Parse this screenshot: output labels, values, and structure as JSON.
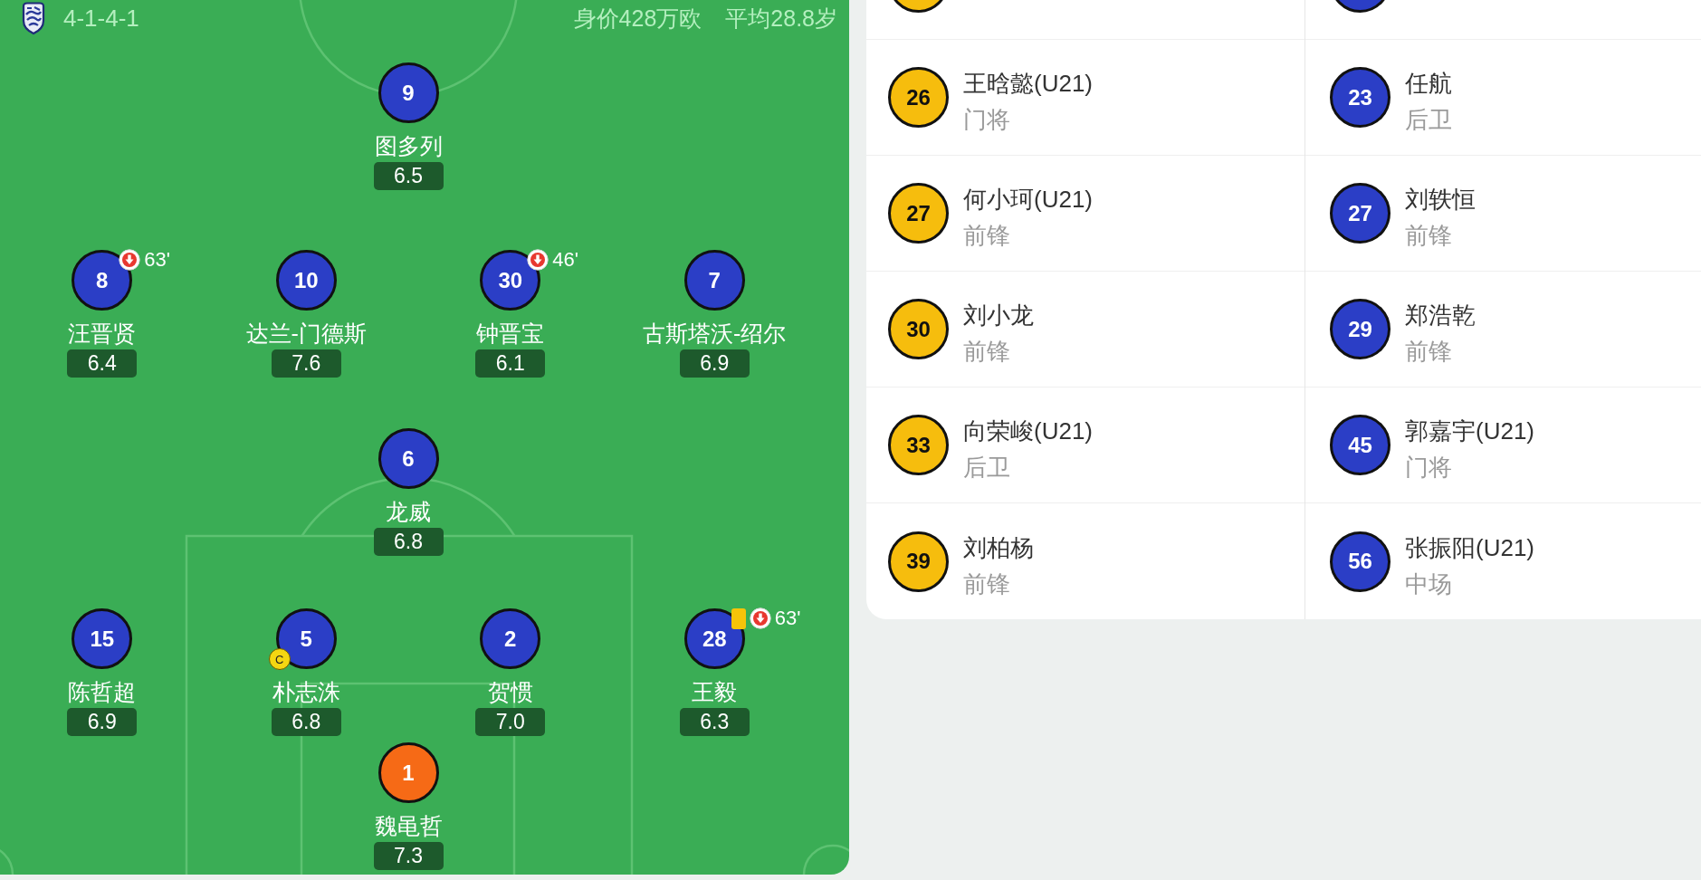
{
  "pitch": {
    "formation": "4-1-4-1",
    "market_value": "身价428万欧",
    "average_age": "平均28.8岁",
    "lines": [
      {
        "players": [
          {
            "number": "9",
            "name": "图多列",
            "rating": "6.5",
            "color": "#2b3ec6"
          }
        ]
      },
      {
        "players": [
          {
            "number": "8",
            "name": "汪晋贤",
            "rating": "6.4",
            "color": "#2b3ec6",
            "events": [
              {
                "kind": "substituted_off",
                "minute": "63'"
              }
            ]
          },
          {
            "number": "10",
            "name": "达兰-门德斯",
            "rating": "7.6",
            "color": "#2b3ec6"
          },
          {
            "number": "30",
            "name": "钟晋宝",
            "rating": "6.1",
            "color": "#2b3ec6",
            "events": [
              {
                "kind": "substituted_off",
                "minute": "46'"
              }
            ]
          },
          {
            "number": "7",
            "name": "古斯塔沃-绍尔",
            "rating": "6.9",
            "color": "#2b3ec6"
          }
        ]
      },
      {
        "players": [
          {
            "number": "6",
            "name": "龙威",
            "rating": "6.8",
            "color": "#2b3ec6"
          }
        ]
      },
      {
        "players": [
          {
            "number": "15",
            "name": "陈哲超",
            "rating": "6.9",
            "color": "#2b3ec6"
          },
          {
            "number": "5",
            "name": "朴志洙",
            "rating": "6.8",
            "color": "#2b3ec6",
            "events": [
              {
                "kind": "captain",
                "label": "C"
              }
            ]
          },
          {
            "number": "2",
            "name": "贺惯",
            "rating": "7.0",
            "color": "#2b3ec6"
          },
          {
            "number": "28",
            "name": "王毅",
            "rating": "6.3",
            "color": "#2b3ec6",
            "events": [
              {
                "kind": "yellow_card"
              },
              {
                "kind": "substituted_off",
                "minute": "63'"
              }
            ]
          }
        ]
      },
      {
        "players": [
          {
            "number": "1",
            "name": "魏黾哲",
            "rating": "7.3",
            "color": "#f66a16"
          }
        ]
      }
    ]
  },
  "substitutes": {
    "columns": [
      {
        "color": "#f6bd0d",
        "players": [
          {
            "number": "26",
            "name": "王晗懿(U21)",
            "position": "门将"
          },
          {
            "number": "27",
            "name": "何小珂(U21)",
            "position": "前锋"
          },
          {
            "number": "30",
            "name": "刘小龙",
            "position": "前锋"
          },
          {
            "number": "33",
            "name": "向荣峻(U21)",
            "position": "后卫"
          },
          {
            "number": "39",
            "name": "刘柏杨",
            "position": "前锋"
          }
        ]
      },
      {
        "color": "#2b3ec6",
        "players": [
          {
            "number": "23",
            "name": "任航",
            "position": "后卫"
          },
          {
            "number": "27",
            "name": "刘轶恒",
            "position": "前锋"
          },
          {
            "number": "29",
            "name": "郑浩乾",
            "position": "前锋"
          },
          {
            "number": "45",
            "name": "郭嘉宇(U21)",
            "position": "门将"
          },
          {
            "number": "56",
            "name": "张振阳(U21)",
            "position": "中场"
          }
        ]
      }
    ]
  }
}
